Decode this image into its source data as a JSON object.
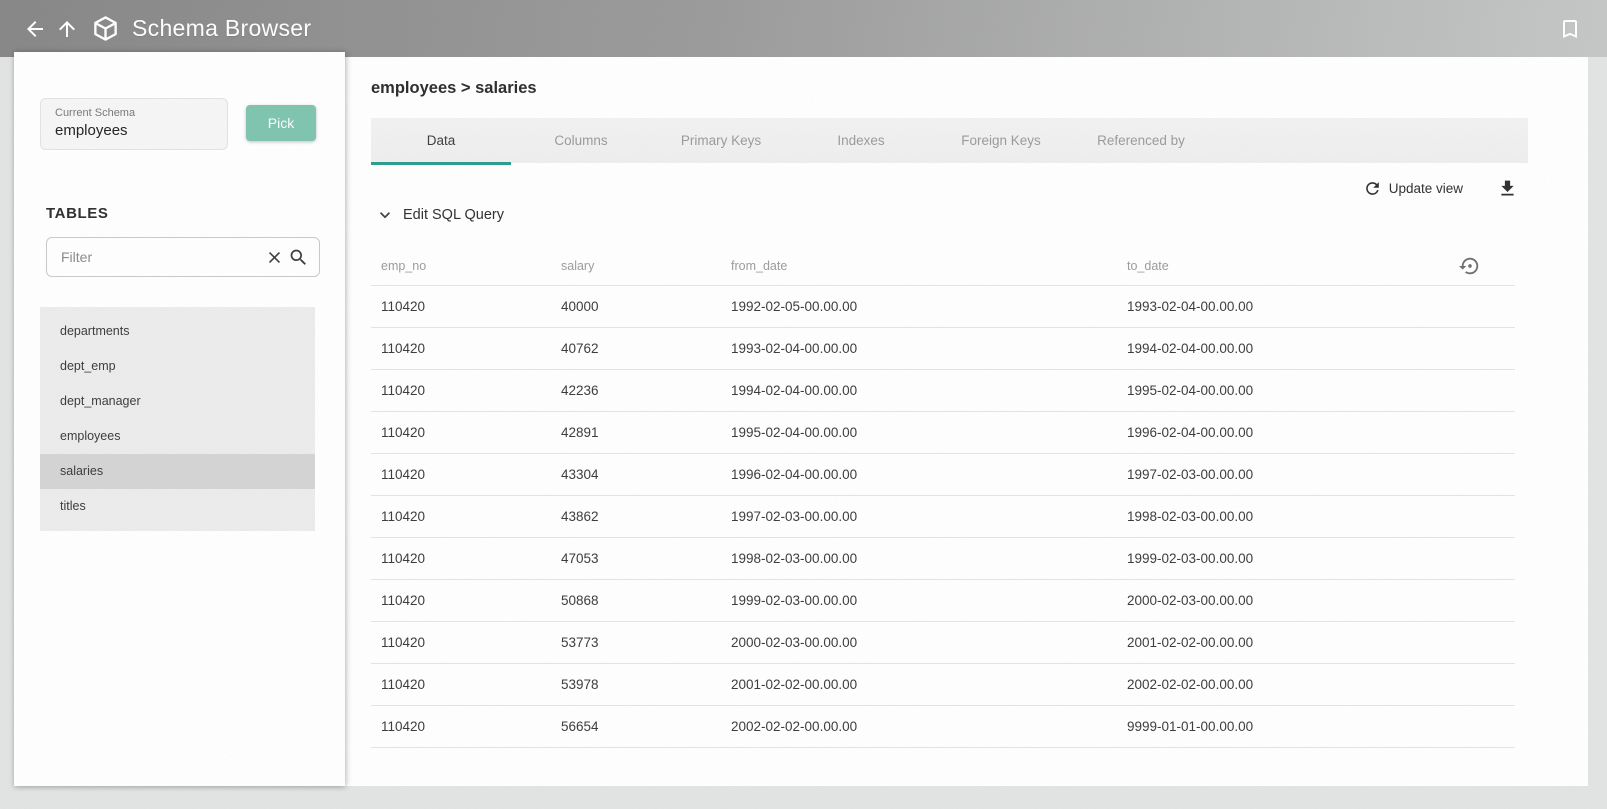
{
  "topbar": {
    "title": "Schema Browser"
  },
  "sidebar": {
    "current_schema": {
      "label": "Current Schema",
      "value": "employees"
    },
    "pick_button_label": "Pick",
    "tables_heading": "TABLES",
    "filter_placeholder": "Filter",
    "tables": [
      {
        "name": "departments",
        "selected": false
      },
      {
        "name": "dept_emp",
        "selected": false
      },
      {
        "name": "dept_manager",
        "selected": false
      },
      {
        "name": "employees",
        "selected": false
      },
      {
        "name": "salaries",
        "selected": true
      },
      {
        "name": "titles",
        "selected": false
      }
    ]
  },
  "main": {
    "breadcrumb": "employees > salaries",
    "tabs": [
      {
        "label": "Data",
        "active": true
      },
      {
        "label": "Columns",
        "active": false
      },
      {
        "label": "Primary Keys",
        "active": false
      },
      {
        "label": "Indexes",
        "active": false
      },
      {
        "label": "Foreign Keys",
        "active": false
      },
      {
        "label": "Referenced by",
        "active": false
      }
    ],
    "update_view_label": "Update view",
    "edit_sql_label": "Edit SQL Query",
    "table": {
      "columns": [
        "emp_no",
        "salary",
        "from_date",
        "to_date"
      ],
      "rows": [
        [
          "110420",
          "40000",
          "1992-02-05-00.00.00",
          "1993-02-04-00.00.00"
        ],
        [
          "110420",
          "40762",
          "1993-02-04-00.00.00",
          "1994-02-04-00.00.00"
        ],
        [
          "110420",
          "42236",
          "1994-02-04-00.00.00",
          "1995-02-04-00.00.00"
        ],
        [
          "110420",
          "42891",
          "1995-02-04-00.00.00",
          "1996-02-04-00.00.00"
        ],
        [
          "110420",
          "43304",
          "1996-02-04-00.00.00",
          "1997-02-03-00.00.00"
        ],
        [
          "110420",
          "43862",
          "1997-02-03-00.00.00",
          "1998-02-03-00.00.00"
        ],
        [
          "110420",
          "47053",
          "1998-02-03-00.00.00",
          "1999-02-03-00.00.00"
        ],
        [
          "110420",
          "50868",
          "1999-02-03-00.00.00",
          "2000-02-03-00.00.00"
        ],
        [
          "110420",
          "53773",
          "2000-02-03-00.00.00",
          "2001-02-02-00.00.00"
        ],
        [
          "110420",
          "53978",
          "2001-02-02-00.00.00",
          "2002-02-02-00.00.00"
        ],
        [
          "110420",
          "56654",
          "2002-02-02-00.00.00",
          "9999-01-01-00.00.00"
        ]
      ]
    }
  },
  "colors": {
    "accent_teal": "#7ec4af",
    "tab_underline": "#2a9c8d"
  }
}
